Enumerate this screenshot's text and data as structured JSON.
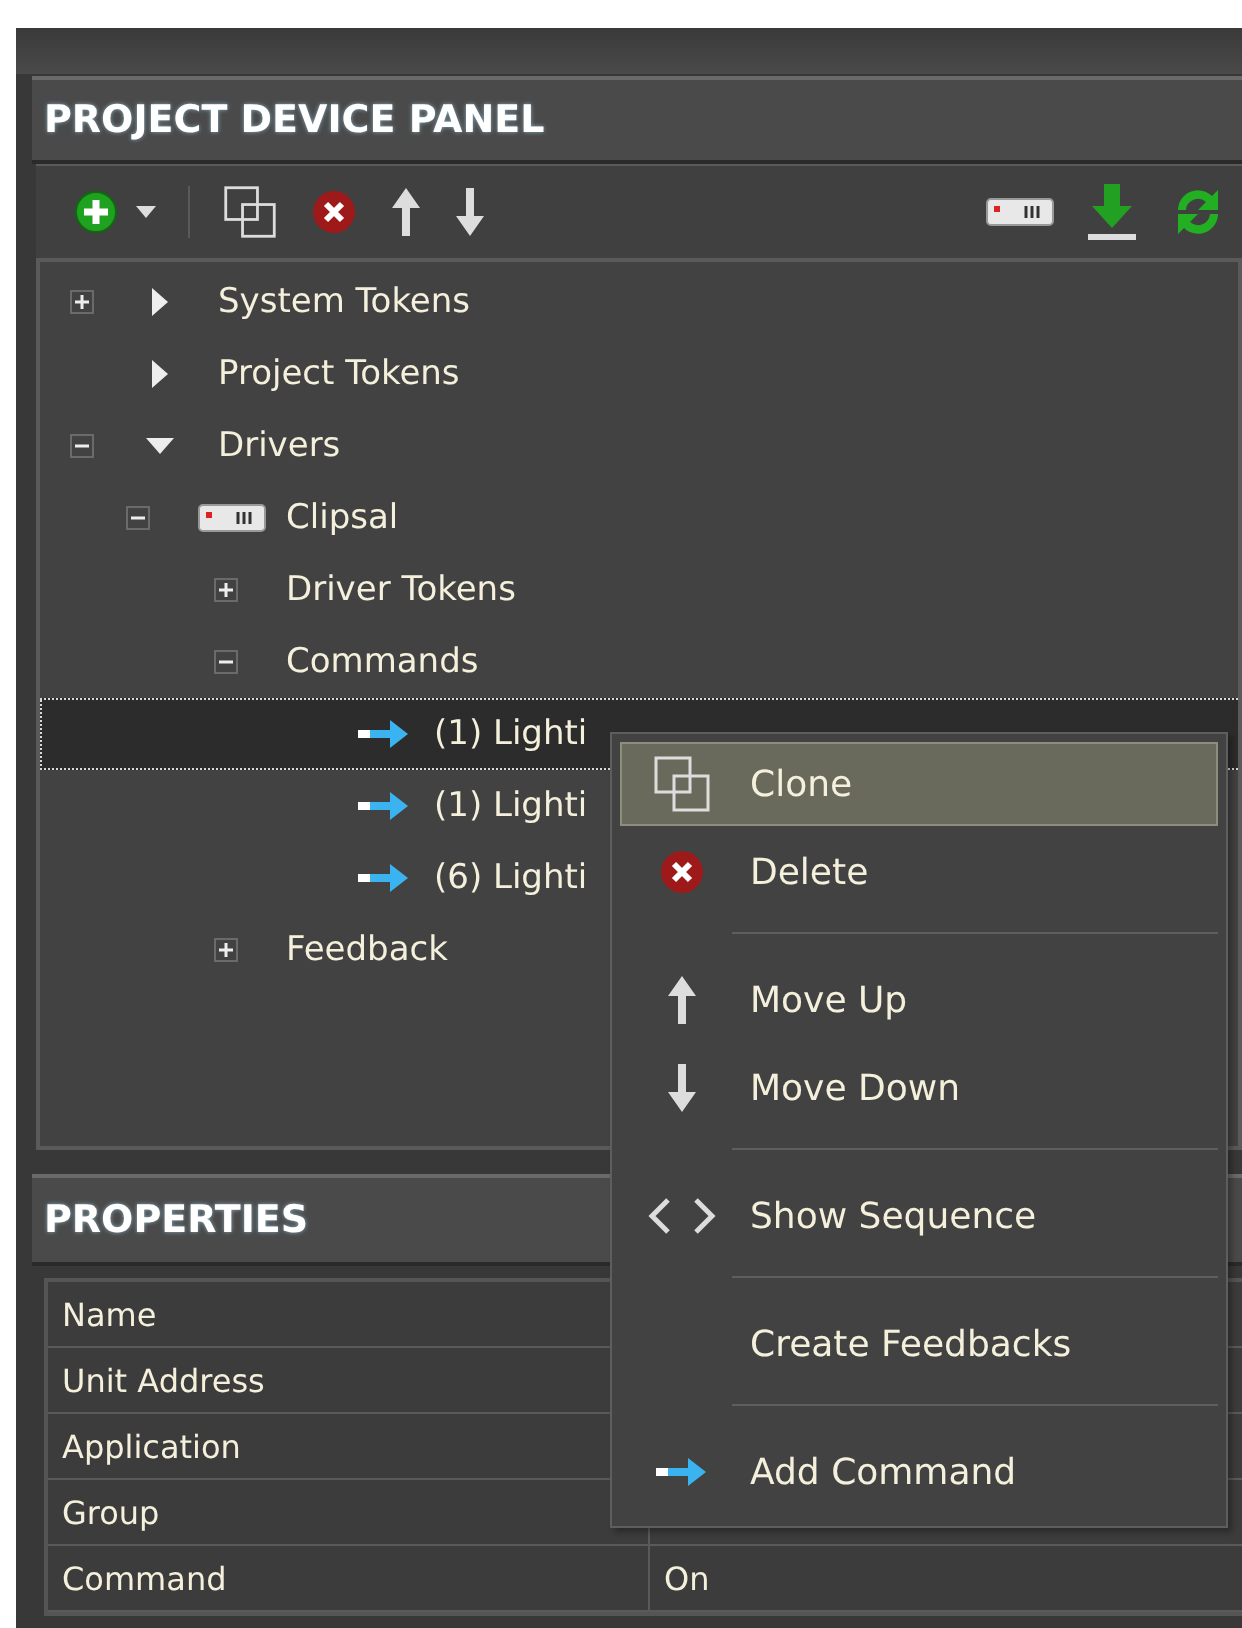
{
  "device_panel": {
    "title": "PROJECT DEVICE PANEL",
    "tree": [
      {
        "label": "System Tokens",
        "kind": "category",
        "expanded": false
      },
      {
        "label": "Project Tokens",
        "kind": "category"
      },
      {
        "label": "Drivers",
        "kind": "category",
        "expanded": true,
        "children": [
          {
            "label": "Clipsal",
            "kind": "driver",
            "expanded": true,
            "children": [
              {
                "label": "Driver Tokens",
                "expanded": false
              },
              {
                "label": "Commands",
                "expanded": true,
                "children": [
                  {
                    "label": "(1) Lighti",
                    "kind": "command",
                    "selected": true
                  },
                  {
                    "label": "(1) Lighti",
                    "kind": "command",
                    "selected": false
                  },
                  {
                    "label": "(6) Lighti",
                    "kind": "command",
                    "selected": false
                  }
                ]
              },
              {
                "label": "Feedback",
                "expanded": false
              }
            ]
          }
        ]
      }
    ]
  },
  "context_menu": [
    {
      "kind": "item",
      "label": "Clone",
      "selected": true
    },
    {
      "kind": "item",
      "label": "Delete",
      "selected": false
    },
    {
      "kind": "separator"
    },
    {
      "kind": "item",
      "label": "Move Up",
      "selected": false
    },
    {
      "kind": "item",
      "label": "Move Down",
      "selected": false
    },
    {
      "kind": "separator"
    },
    {
      "kind": "item",
      "label": "Show Sequence",
      "selected": false
    },
    {
      "kind": "separator"
    },
    {
      "kind": "item",
      "label": "Create Feedbacks",
      "selected": false
    },
    {
      "kind": "separator"
    },
    {
      "kind": "item",
      "label": "Add Command",
      "selected": false
    }
  ],
  "properties": {
    "title": "PROPERTIES",
    "rows": [
      {
        "name": "Name"
      },
      {
        "name": "Unit Address"
      },
      {
        "name": "Application"
      },
      {
        "name": "Group"
      },
      {
        "name": "Command",
        "value": "On"
      }
    ]
  }
}
